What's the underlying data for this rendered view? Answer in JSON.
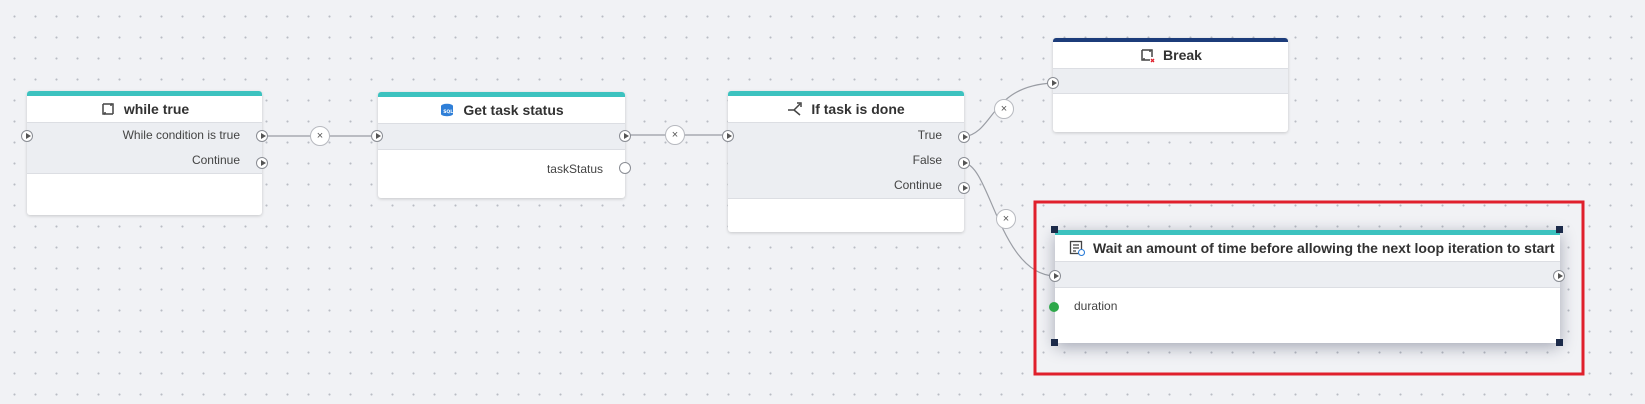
{
  "nodes": {
    "while": {
      "title": "while true",
      "rows": [
        "While condition is true",
        "Continue"
      ]
    },
    "get_task": {
      "title": "Get task status",
      "output": "taskStatus"
    },
    "if_done": {
      "title": "If task is done",
      "rows": [
        "True",
        "False",
        "Continue"
      ]
    },
    "break": {
      "title": "Break"
    },
    "wait": {
      "title": "Wait an amount of time before allowing the next loop iteration to start",
      "input": "duration"
    }
  },
  "disconnect_symbol": "×",
  "colors": {
    "canvas": "#f1f2f5",
    "node_accent": "#3cc2bf",
    "break_accent": "#1c3c7a",
    "selection": "#e0202c",
    "input_port": "#2ea84a"
  }
}
